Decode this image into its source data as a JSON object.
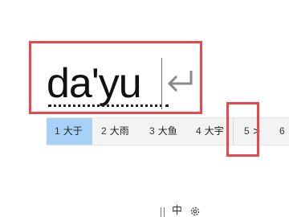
{
  "composition": {
    "text": "da'yu"
  },
  "candidates": [
    {
      "num": "1",
      "word": "大于"
    },
    {
      "num": "2",
      "word": "大雨"
    },
    {
      "num": "3",
      "word": "大鱼"
    },
    {
      "num": "4",
      "word": "大宇"
    },
    {
      "num": "5",
      "word": ">"
    },
    {
      "num": "6",
      "word": ""
    }
  ],
  "tray": {
    "ime_mode": "中"
  },
  "colors": {
    "annotation": "#e8484d",
    "selected": "#a8d1f7",
    "bar": "#f3f3f3"
  },
  "icons": {
    "enter": "enter-arrow-icon",
    "settings": "gear-icon"
  }
}
